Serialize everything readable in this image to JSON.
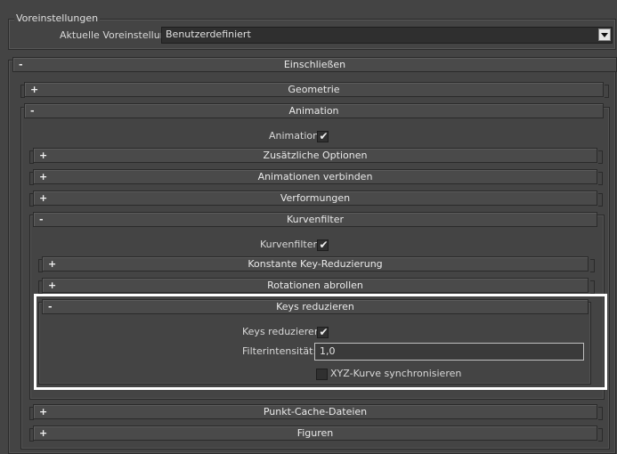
{
  "presets": {
    "group_title": "Voreinstellungen",
    "current_label": "Aktuelle Voreinstellung:",
    "current_value": "Benutzerdefiniert"
  },
  "rollouts": {
    "include": {
      "sign": "-",
      "title": "Einschließen"
    },
    "geometry": {
      "sign": "+",
      "title": "Geometrie"
    },
    "animation": {
      "sign": "-",
      "title": "Animation"
    },
    "extra_options": {
      "sign": "+",
      "title": "Zusätzliche Optionen"
    },
    "bake_animation": {
      "sign": "+",
      "title": "Animationen verbinden"
    },
    "deformations": {
      "sign": "+",
      "title": "Verformungen"
    },
    "curve_filters": {
      "sign": "-",
      "title": "Kurvenfilter"
    },
    "constant_key_reduction": {
      "sign": "+",
      "title": "Konstante Key-Reduzierung"
    },
    "unroll_rotations": {
      "sign": "+",
      "title": "Rotationen abrollen"
    },
    "reduce_keys": {
      "sign": "-",
      "title": "Keys reduzieren"
    },
    "point_cache": {
      "sign": "+",
      "title": "Punkt-Cache-Dateien"
    },
    "shapes": {
      "sign": "+",
      "title": "Figuren"
    }
  },
  "animation": {
    "checkbox_label": "Animation",
    "checked": true
  },
  "curve_filters": {
    "checkbox_label": "Kurvenfilter",
    "checked": true
  },
  "reduce_keys": {
    "checkbox_label": "Keys reduzieren",
    "checked": true,
    "intensity_label": "Filterintensität:",
    "intensity_value": "1,0",
    "sync_xyz_label": "XYZ-Kurve synchronisieren",
    "sync_xyz_checked": false
  },
  "marks": {
    "check": "✔"
  }
}
